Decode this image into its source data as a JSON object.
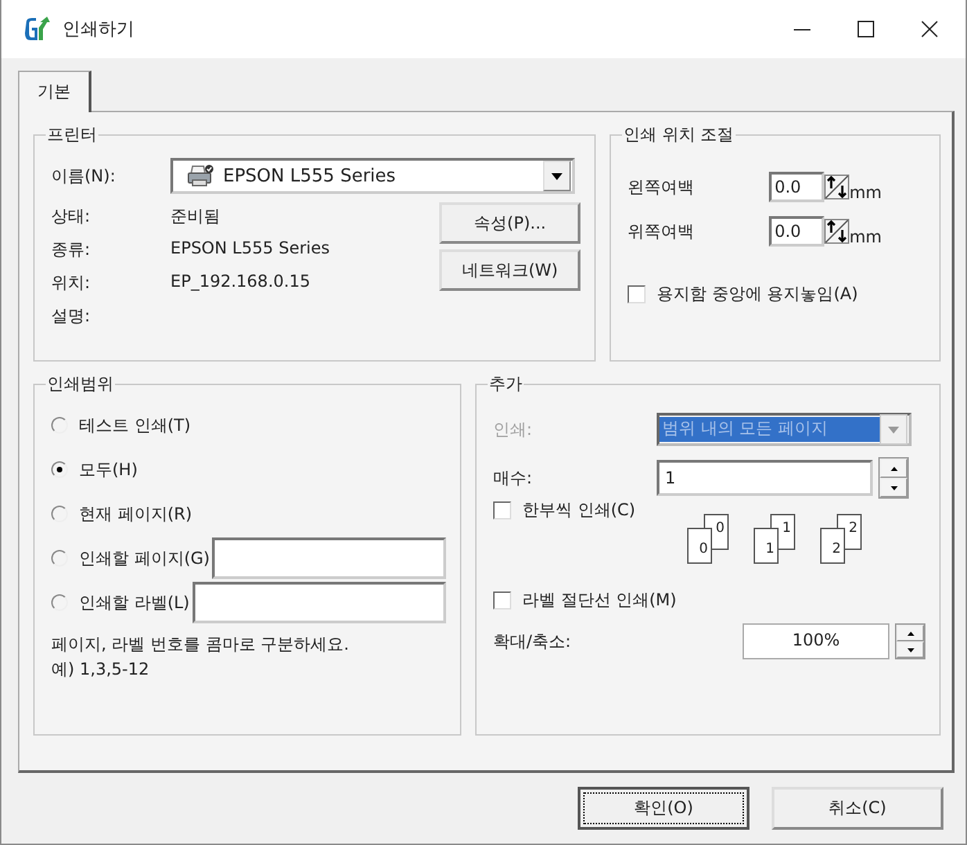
{
  "window": {
    "title": "인쇄하기"
  },
  "tabs": [
    {
      "label": "기본",
      "selected": true
    }
  ],
  "printer": {
    "title": "프린터",
    "name_label": "이름(N):",
    "name_value": "EPSON L555 Series",
    "fields": [
      {
        "label": "상태:",
        "value": "준비됨"
      },
      {
        "label": "종류:",
        "value": "EPSON L555 Series"
      },
      {
        "label": "위치:",
        "value": "EP_192.168.0.15"
      },
      {
        "label": "설명:"
      }
    ],
    "buttons": [
      "속성(P)...",
      "네트워크(W)"
    ]
  },
  "position": {
    "title": "인쇄 위치 조절",
    "margins": [
      {
        "label": "왼쪽여백",
        "value": "0.0",
        "unit": "mm"
      },
      {
        "label": "위쪽여백",
        "value": "0.0",
        "unit": "mm"
      }
    ],
    "center": {
      "label": "용지함 중앙에 용지놓임(A)",
      "checked": false
    }
  },
  "range": {
    "title": "인쇄범위",
    "options": [
      {
        "label": "테스트 인쇄(T)",
        "selected": false,
        "kind": "plain"
      },
      {
        "label": "모두(H)",
        "selected": true,
        "kind": "plain"
      },
      {
        "label": "현재 페이지(R)",
        "selected": false,
        "kind": "plain"
      },
      {
        "label": "인쇄할 페이지(G)",
        "selected": false,
        "kind": "input"
      },
      {
        "label": "인쇄할 라벨(L)",
        "selected": false,
        "kind": "input"
      }
    ],
    "note": [
      "페이지, 라벨 번호를 콤마로 구분하세요.",
      "예) 1,3,5-12"
    ]
  },
  "extra": {
    "title": "추가",
    "print_label": "인쇄:",
    "print_value": "범위 내의 모든 페이지",
    "print_disabled": true,
    "copies_label": "매수:",
    "copies_value": "1",
    "collate": {
      "label": "한부씩 인쇄(C)",
      "checked": false
    },
    "collate_pages": [
      {
        "back": "0",
        "front": "0"
      },
      {
        "back": "1",
        "front": "1"
      },
      {
        "back": "2",
        "front": "2"
      }
    ],
    "cut_lines": {
      "label": "라벨 절단선 인쇄(M)",
      "checked": false
    },
    "scale_label": "확대/축소:",
    "scale_value": "100%"
  },
  "buttons": [
    {
      "label": "확인(O)",
      "default": true
    },
    {
      "label": "취소(C)",
      "default": false
    }
  ]
}
